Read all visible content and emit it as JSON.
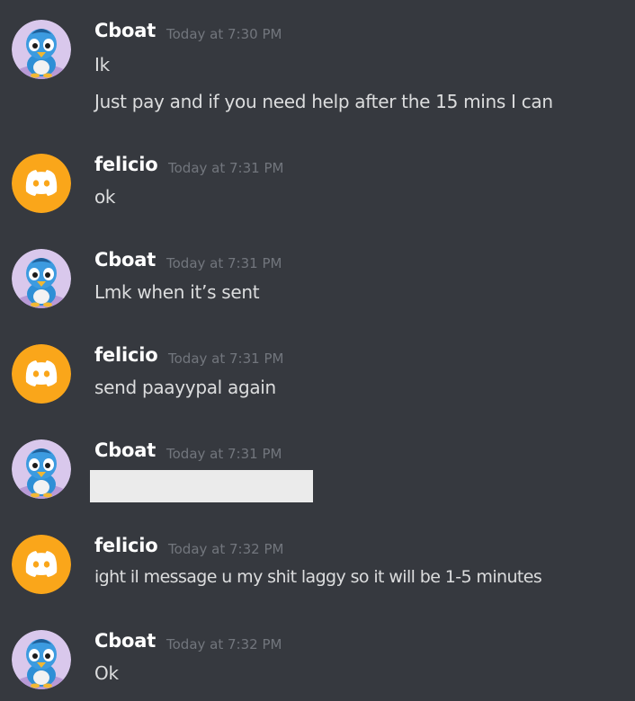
{
  "messages": [
    {
      "author": "Cboat",
      "avatar_icon": "piplup-avatar-icon",
      "timestamp": "Today at 7:30 PM",
      "lines": [
        "Ik",
        "Just pay and if you need help after the 15 mins I can"
      ]
    },
    {
      "author": "felicio",
      "avatar_icon": "discord-default-avatar-icon",
      "timestamp": "Today at 7:31 PM",
      "lines": [
        "ok"
      ]
    },
    {
      "author": "Cboat",
      "avatar_icon": "piplup-avatar-icon",
      "timestamp": "Today at 7:31 PM",
      "lines": [
        "Lmk when it’s sent"
      ]
    },
    {
      "author": "felicio",
      "avatar_icon": "discord-default-avatar-icon",
      "timestamp": "Today at 7:31 PM",
      "lines": [
        "send paayypal again"
      ]
    },
    {
      "author": "Cboat",
      "avatar_icon": "piplup-avatar-icon",
      "timestamp": "Today at 7:31 PM",
      "lines": [],
      "redacted": true
    },
    {
      "author": "felicio",
      "avatar_icon": "discord-default-avatar-icon",
      "timestamp": "Today at 7:32 PM",
      "lines": [
        "ight il message u my shit laggy so  it will be 1-5 minutes"
      ]
    },
    {
      "author": "Cboat",
      "avatar_icon": "piplup-avatar-icon",
      "timestamp": "Today at 7:32 PM",
      "lines": [
        "Ok"
      ]
    }
  ],
  "colors": {
    "background": "#36393f",
    "username": "#ffffff",
    "timestamp": "#72767d",
    "message_text": "#dcddde",
    "discord_orange": "#faa61a",
    "redaction": "#ebebeb"
  }
}
